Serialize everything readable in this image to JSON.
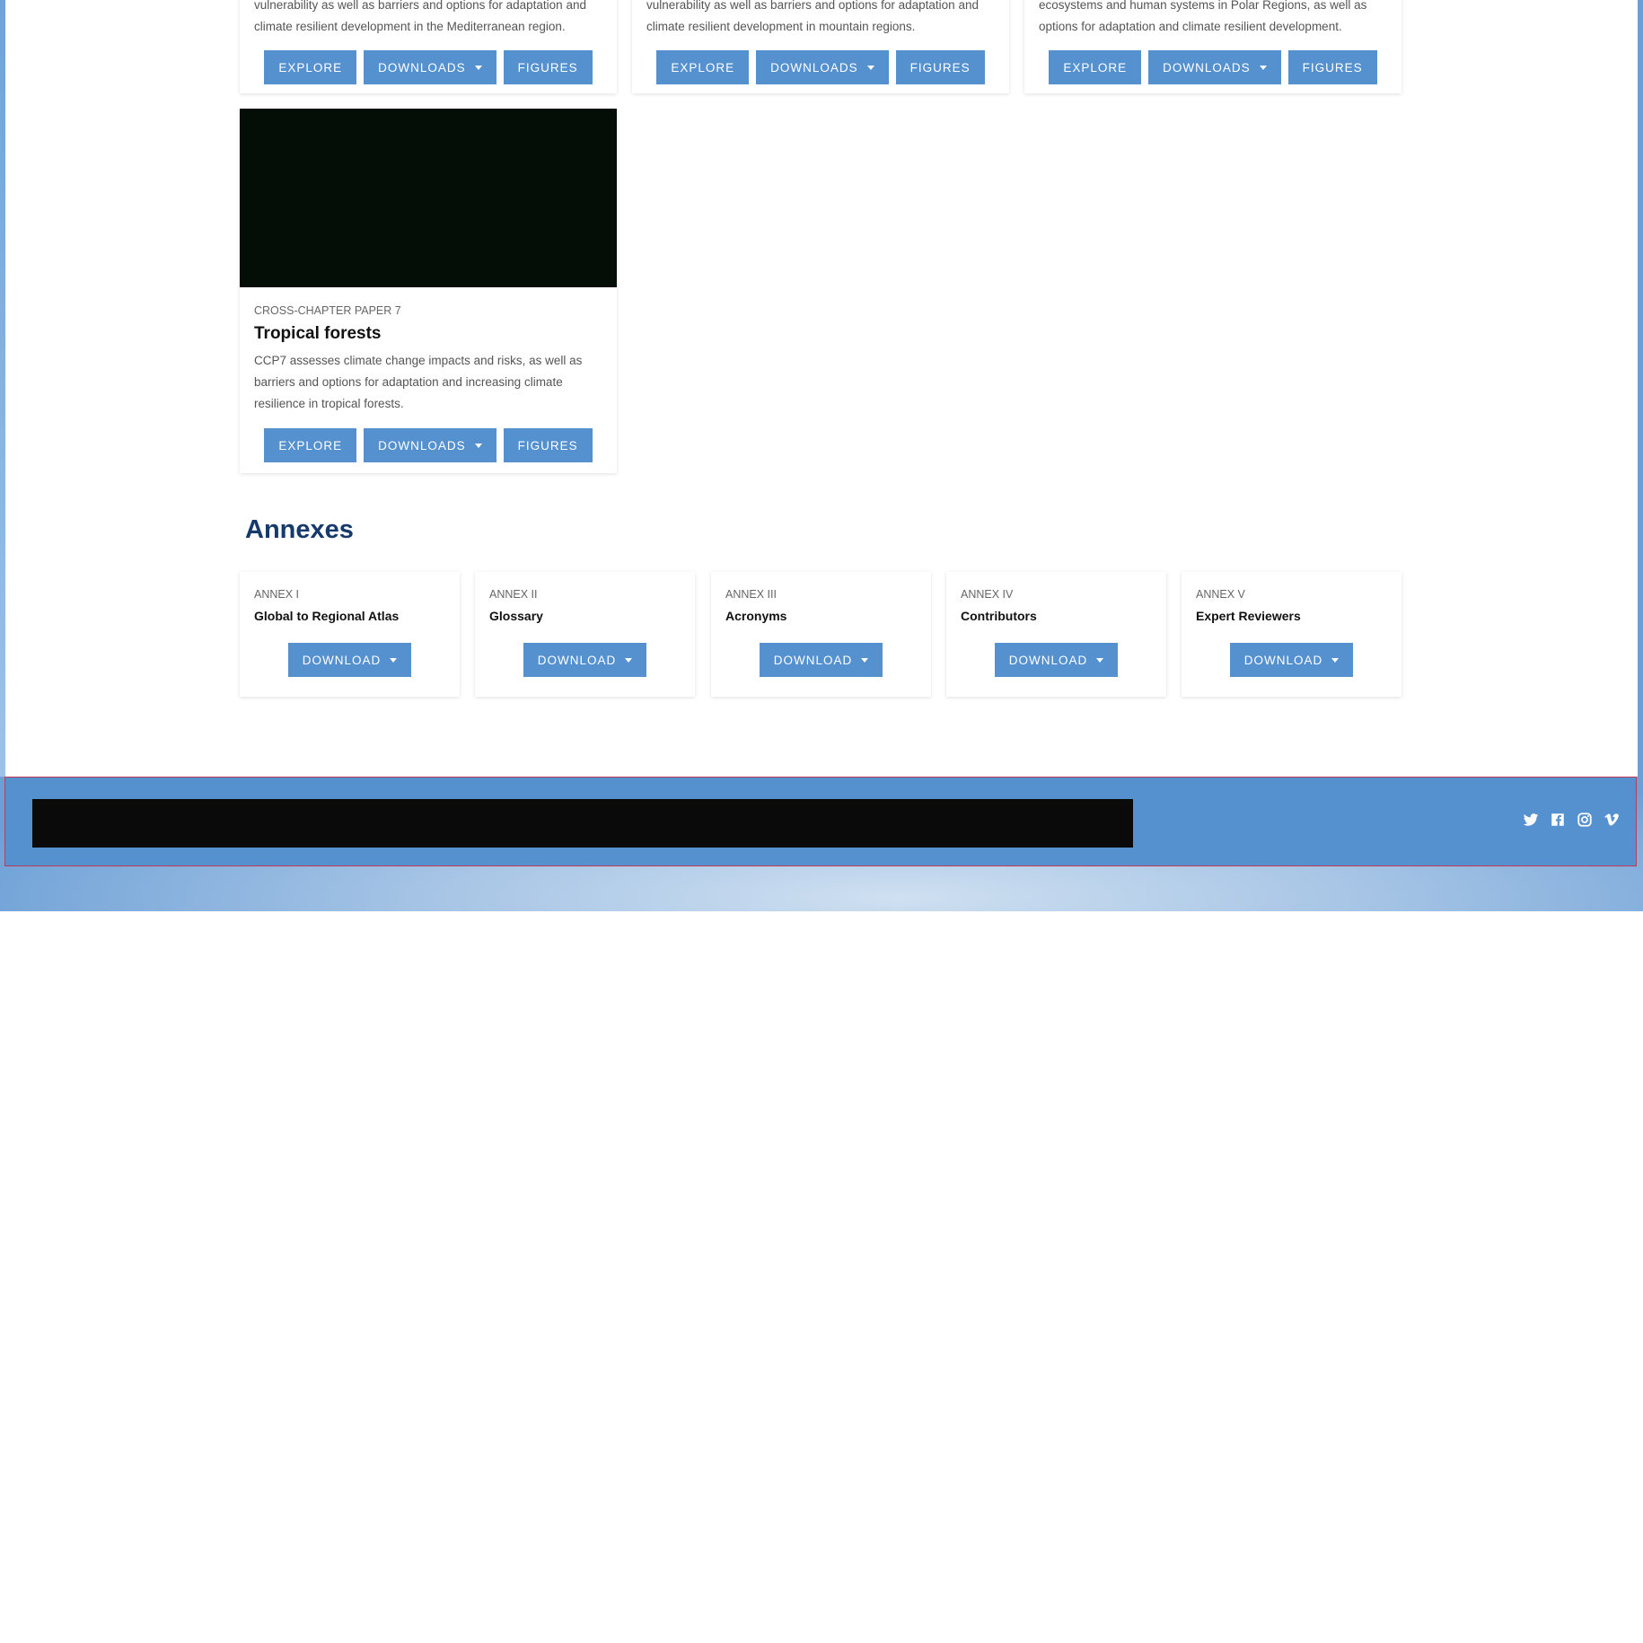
{
  "cards_top": [
    {
      "desc_line1": "vulnerability as well as barriers and options for adaptation and",
      "desc_line2": "climate resilient development in the Mediterranean region.",
      "buttons": {
        "explore": "EXPLORE",
        "downloads": "DOWNLOADS",
        "figures": "FIGURES"
      }
    },
    {
      "desc_line1": "vulnerability as well as barriers and options for adaptation and",
      "desc_line2": "climate resilient development in mountain regions.",
      "buttons": {
        "explore": "EXPLORE",
        "downloads": "DOWNLOADS",
        "figures": "FIGURES"
      }
    },
    {
      "desc_line1": "ecosystems and human systems in Polar Regions, as well as",
      "desc_line2": "options for adaptation and climate resilient development.",
      "buttons": {
        "explore": "EXPLORE",
        "downloads": "DOWNLOADS",
        "figures": "FIGURES"
      }
    }
  ],
  "ccp7": {
    "kicker": "CROSS-CHAPTER PAPER 7",
    "title": "Tropical forests",
    "desc_line1": "CCP7 assesses climate change impacts and risks, as well as",
    "desc_line2": "barriers and options for adaptation and increasing climate",
    "desc_line3": "resilience in tropical forests.",
    "image_color": "#040d06",
    "buttons": {
      "explore": "EXPLORE",
      "downloads": "DOWNLOADS",
      "figures": "FIGURES"
    }
  },
  "annexes": {
    "heading": "Annexes",
    "items": [
      {
        "kicker": "ANNEX I",
        "title": "Global to Regional Atlas",
        "button": "DOWNLOAD"
      },
      {
        "kicker": "ANNEX II",
        "title": "Glossary",
        "button": "DOWNLOAD"
      },
      {
        "kicker": "ANNEX III",
        "title": "Acronyms",
        "button": "DOWNLOAD"
      },
      {
        "kicker": "ANNEX IV",
        "title": "Contributors",
        "button": "DOWNLOAD"
      },
      {
        "kicker": "ANNEX V",
        "title": "Expert Reviewers",
        "button": "DOWNLOAD"
      }
    ]
  },
  "footer": {
    "social_icons": [
      "twitter-icon",
      "facebook-icon",
      "instagram-icon",
      "vimeo-icon"
    ]
  },
  "colors": {
    "button": "#5591cf",
    "heading": "#153a6b",
    "footer": "#5591cf"
  }
}
